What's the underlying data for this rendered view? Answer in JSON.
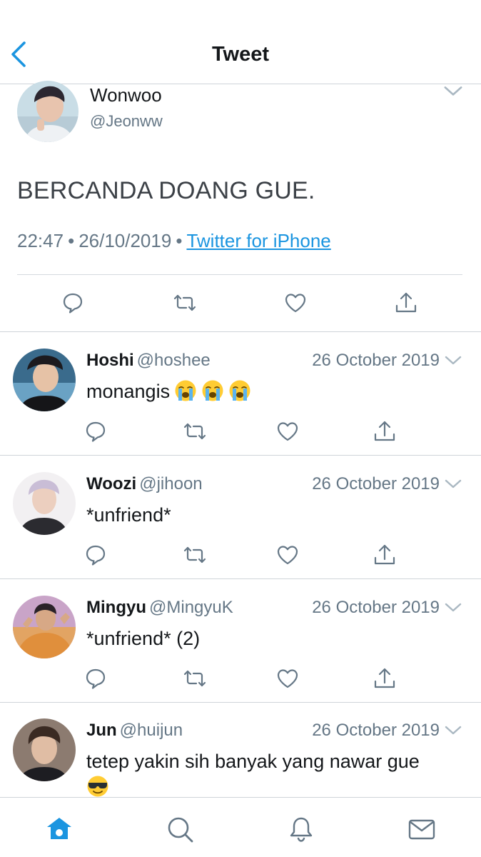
{
  "header": {
    "title": "Tweet"
  },
  "main_tweet": {
    "name": "Wonwoo",
    "handle": "@Jeonww",
    "text": "BERCANDA DOANG GUE.",
    "time": "22:47",
    "date": "26/10/2019",
    "separator": "•",
    "source": "Twitter for iPhone"
  },
  "replies": [
    {
      "name": "Hoshi",
      "handle": "@hoshee",
      "date": "26 October 2019",
      "text": "monangis",
      "emoji": [
        "loudly-crying-face",
        "loudly-crying-face",
        "loudly-crying-face"
      ]
    },
    {
      "name": "Woozi",
      "handle": "@jihoon",
      "date": "26 October 2019",
      "text": "*unfriend*"
    },
    {
      "name": "Mingyu",
      "handle": "@MingyuK",
      "date": "26 October 2019",
      "text": "*unfriend* (2)"
    },
    {
      "name": "Jun",
      "handle": "@huijun",
      "date": "26 October 2019",
      "text": "tetep yakin sih banyak yang nawar gue",
      "emoji": [
        "smiling-face-with-sunglasses"
      ]
    }
  ],
  "tabs": [
    "home",
    "search",
    "notifications",
    "messages"
  ],
  "colors": {
    "accent": "#1b95e0",
    "icon_gray": "#657786",
    "divider": "#cfd4d9",
    "text": "#14171a"
  }
}
